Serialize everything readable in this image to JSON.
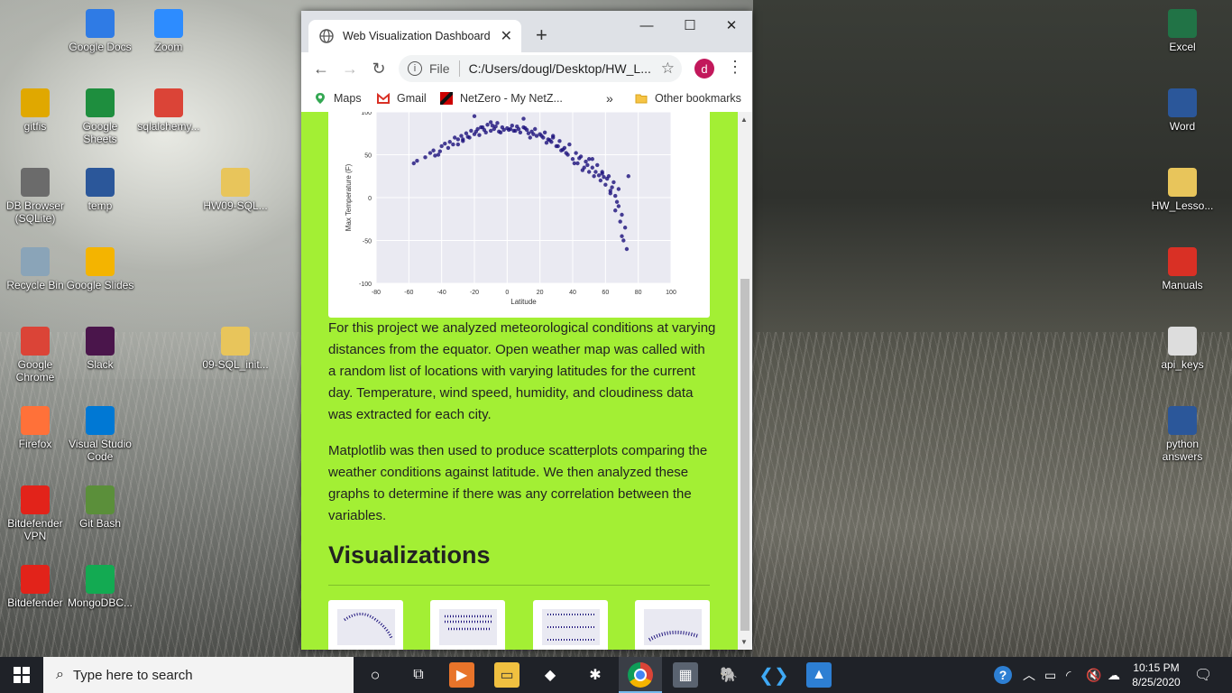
{
  "desktop": {
    "icons_left": [
      {
        "label": "Google Docs",
        "icon": "google-docs-icon",
        "color": "#2f7be5"
      },
      {
        "label": "Zoom",
        "icon": "zoom-icon",
        "color": "#2d8cff"
      },
      {
        "label": "gitfis",
        "icon": "chrome-folder-icon",
        "color": "#e0a800"
      },
      {
        "label": "Google Sheets",
        "icon": "google-sheets-icon",
        "color": "#1e8e3e"
      },
      {
        "label": "sqlalchemy...",
        "icon": "chrome-icon",
        "color": "#db4437"
      },
      {
        "label": "DB Browser (SQLite)",
        "icon": "database-icon",
        "color": "#6b6b6b"
      },
      {
        "label": "temp",
        "icon": "word-doc-icon",
        "color": "#2b579a"
      },
      {
        "label": "HW09-SQL...",
        "icon": "folder-icon",
        "color": "#e8c55b"
      },
      {
        "label": "Recycle Bin",
        "icon": "recycle-bin-icon",
        "color": "#8aa4b8"
      },
      {
        "label": "Google Slides",
        "icon": "google-slides-icon",
        "color": "#f4b400"
      },
      {
        "label": "Google Chrome",
        "icon": "chrome-icon",
        "color": "#db4437"
      },
      {
        "label": "Slack",
        "icon": "slack-icon",
        "color": "#4a154b"
      },
      {
        "label": "09-SQL_init...",
        "icon": "folder-icon",
        "color": "#e8c55b"
      },
      {
        "label": "Firefox",
        "icon": "firefox-icon",
        "color": "#ff7139"
      },
      {
        "label": "Visual Studio Code",
        "icon": "vscode-icon",
        "color": "#0078d4"
      },
      {
        "label": "Bitdefender VPN",
        "icon": "bitdefender-vpn-icon",
        "color": "#e2231a"
      },
      {
        "label": "Git Bash",
        "icon": "git-bash-icon",
        "color": "#5b8f3a"
      },
      {
        "label": "Bitdefender",
        "icon": "bitdefender-icon",
        "color": "#e2231a"
      },
      {
        "label": "MongoDBC...",
        "icon": "mongodb-icon",
        "color": "#13aa52"
      }
    ],
    "icons_right": [
      {
        "label": "Excel",
        "icon": "excel-icon",
        "color": "#217346"
      },
      {
        "label": "Word",
        "icon": "word-icon",
        "color": "#2b579a"
      },
      {
        "label": "HW_Lesso...",
        "icon": "file-icon",
        "color": "#e8c55b"
      },
      {
        "label": "Manuals",
        "icon": "pdf-icon",
        "color": "#d93025"
      },
      {
        "label": "api_keys",
        "icon": "text-file-icon",
        "color": "#dddddd"
      },
      {
        "label": "python answers",
        "icon": "word-doc-icon",
        "color": "#2b579a"
      }
    ]
  },
  "browser": {
    "tab_title": "Web Visualization Dashboard",
    "address_scheme": "File",
    "address_url": "C:/Users/dougl/Desktop/HW_L...",
    "profile_initial": "d",
    "bookmarks": [
      "Maps",
      "Gmail",
      "NetZero - My NetZ...",
      "Other bookmarks"
    ],
    "overflow": "»"
  },
  "page": {
    "paragraph1": "For this project we analyzed meteorological conditions at varying distances from the equator. Open weather map was called with a random list of locations with varying latitudes for the current day. Temperature, wind speed, humidity, and cloudiness data was extracted for each city.",
    "paragraph2": "Matplotlib was then used to produce scatterplots comparing the weather conditions against latitude. We then analyzed these graphs to determine if there was any correlation between the variables.",
    "visualizations_heading": "Visualizations",
    "background_color": "#a3ef34"
  },
  "chart_data": {
    "type": "scatter",
    "title": "",
    "xlabel": "Latitude",
    "ylabel": "Max Temperature (F)",
    "xlim": [
      -80,
      100
    ],
    "ylim": [
      -100,
      100
    ],
    "xticks": [
      -80,
      -60,
      -40,
      -20,
      0,
      20,
      40,
      60,
      80,
      100
    ],
    "yticks": [
      100,
      50,
      0,
      -50,
      -100
    ],
    "grid": true,
    "point_color": "#1a0f7a",
    "x": [
      -57,
      -55,
      -50,
      -47,
      -45,
      -42,
      -40,
      -38,
      -35,
      -33,
      -32,
      -30,
      -28,
      -27,
      -25,
      -23,
      -22,
      -20,
      -18,
      -17,
      -15,
      -13,
      -12,
      -10,
      -8,
      -7,
      -5,
      -3,
      -2,
      0,
      2,
      3,
      5,
      7,
      8,
      10,
      12,
      13,
      15,
      17,
      18,
      20,
      22,
      23,
      25,
      27,
      28,
      30,
      32,
      33,
      35,
      37,
      38,
      40,
      42,
      43,
      45,
      47,
      48,
      50,
      52,
      53,
      55,
      57,
      58,
      60,
      62,
      63,
      65,
      67,
      68,
      70,
      72,
      -36,
      -24,
      -14,
      -4,
      6,
      16,
      26,
      36,
      44,
      52,
      58,
      64,
      68,
      71,
      -44,
      -30,
      -19,
      -9,
      1,
      11,
      21,
      31,
      41,
      49,
      56,
      61,
      66,
      70,
      -41,
      -27,
      -16,
      -6,
      4,
      14,
      24,
      34,
      46,
      54,
      59,
      63,
      69,
      73,
      -20,
      -10,
      10,
      28,
      50,
      66,
      74
    ],
    "y": [
      40,
      43,
      47,
      52,
      55,
      50,
      60,
      63,
      65,
      62,
      70,
      68,
      72,
      66,
      75,
      70,
      78,
      74,
      80,
      73,
      82,
      76,
      85,
      78,
      80,
      83,
      77,
      82,
      79,
      81,
      80,
      84,
      78,
      80,
      76,
      82,
      79,
      75,
      77,
      80,
      72,
      74,
      70,
      76,
      68,
      65,
      72,
      60,
      66,
      55,
      58,
      50,
      62,
      45,
      52,
      40,
      48,
      35,
      42,
      30,
      45,
      25,
      38,
      20,
      30,
      15,
      25,
      5,
      18,
      -5,
      10,
      -20,
      -35,
      58,
      71,
      79,
      76,
      83,
      74,
      67,
      52,
      46,
      35,
      28,
      12,
      -10,
      -50,
      49,
      62,
      77,
      84,
      79,
      81,
      72,
      60,
      40,
      38,
      26,
      22,
      2,
      -45,
      54,
      68,
      82,
      87,
      78,
      70,
      64,
      56,
      32,
      30,
      24,
      8,
      -28,
      -60,
      95,
      88,
      92,
      70,
      45,
      -15,
      25
    ]
  },
  "taskbar": {
    "search_placeholder": "Type here to search",
    "time": "10:15 PM",
    "date": "8/25/2020"
  }
}
